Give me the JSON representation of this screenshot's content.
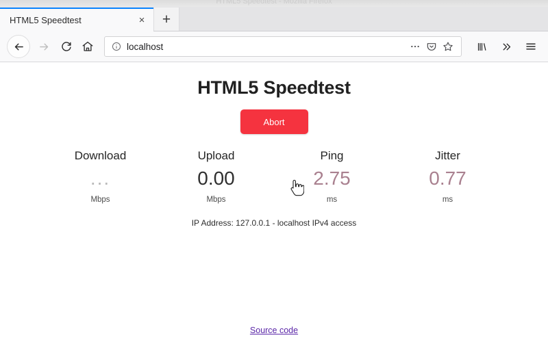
{
  "window": {
    "ghost_title": "HTML5 Speedtest - Mozilla Firefox"
  },
  "tabbar": {
    "tabs": [
      {
        "title": "HTML5 Speedtest",
        "close_icon": "×",
        "active": true
      }
    ],
    "new_tab_label": "+",
    "active_tab_accent": "#0a84ff"
  },
  "navbar": {
    "back_label": "Back",
    "forward_label": "Forward",
    "reload_label": "Reload",
    "home_label": "Home",
    "url": "localhost",
    "url_placeholder": "Search or enter address",
    "page_actions_label": "…",
    "pocket_label": "Save to Pocket",
    "bookmark_label": "Bookmark this page",
    "library_label": "Library",
    "overflow_label": "»",
    "menu_label": "Open menu"
  },
  "page": {
    "title": "HTML5 Speedtest",
    "abort_button": "Abort",
    "abort_button_color": "#f5333f",
    "metrics": [
      {
        "label": "Download",
        "value": "...",
        "unit": "Mbps",
        "state": "pending"
      },
      {
        "label": "Upload",
        "value": "0.00",
        "unit": "Mbps",
        "state": "done"
      },
      {
        "label": "Ping",
        "value": "2.75",
        "unit": "ms",
        "state": "latency"
      },
      {
        "label": "Jitter",
        "value": "0.77",
        "unit": "ms",
        "state": "latency"
      }
    ],
    "ip_line": "IP Address: 127.0.0.1 - localhost IPv4 access",
    "source_link": "Source code",
    "link_color": "#5b27a8",
    "latency_color": "#a9808f"
  }
}
